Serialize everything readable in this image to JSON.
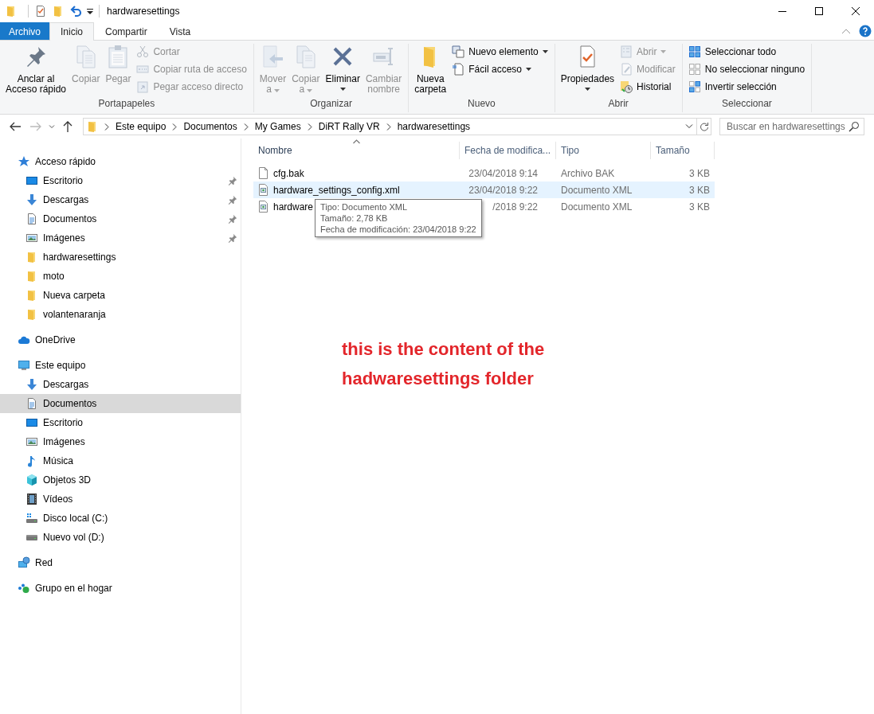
{
  "window": {
    "title": "hardwaresettings"
  },
  "ribbon": {
    "tabs": [
      {
        "label": "Archivo",
        "kind": "file",
        "selected": false
      },
      {
        "label": "Inicio",
        "kind": "tab",
        "selected": true
      },
      {
        "label": "Compartir",
        "kind": "tab",
        "selected": false
      },
      {
        "label": "Vista",
        "kind": "tab",
        "selected": false
      }
    ],
    "groups": [
      {
        "label": "Portapapeles",
        "large": [
          {
            "label": "Anclar al\nAcceso rápido",
            "kind": "pin",
            "disabled": false,
            "dropdown": false
          },
          {
            "label": "Copiar",
            "kind": "copy",
            "disabled": true,
            "dropdown": false
          },
          {
            "label": "Pegar",
            "kind": "paste",
            "disabled": true,
            "dropdown": false
          }
        ],
        "small": [
          {
            "label": "Cortar",
            "kind": "cut",
            "disabled": true,
            "dropdown": false
          },
          {
            "label": "Copiar ruta de acceso",
            "kind": "copypath",
            "disabled": true,
            "dropdown": false
          },
          {
            "label": "Pegar acceso directo",
            "kind": "pasteshortcut",
            "disabled": true,
            "dropdown": false
          }
        ]
      },
      {
        "label": "Organizar",
        "large": [
          {
            "label": "Mover\na",
            "kind": "move",
            "disabled": true,
            "dropdown": true
          },
          {
            "label": "Copiar\na",
            "kind": "copyto",
            "disabled": true,
            "dropdown": true
          },
          {
            "label": "Eliminar",
            "kind": "delete",
            "disabled": false,
            "dropdown": true
          },
          {
            "label": "Cambiar\nnombre",
            "kind": "rename",
            "disabled": true,
            "dropdown": false
          }
        ]
      },
      {
        "label": "Nuevo",
        "large": [
          {
            "label": "Nueva\ncarpeta",
            "kind": "newfolder",
            "disabled": false,
            "dropdown": false
          }
        ],
        "small": [
          {
            "label": "Nuevo elemento",
            "kind": "newitem",
            "disabled": false,
            "dropdown": true
          },
          {
            "label": "Fácil acceso",
            "kind": "easyaccess",
            "disabled": false,
            "dropdown": true
          }
        ]
      },
      {
        "label": "Abrir",
        "large": [
          {
            "label": "Propiedades",
            "kind": "properties",
            "disabled": false,
            "dropdown": true
          }
        ],
        "small": [
          {
            "label": "Abrir",
            "kind": "open",
            "disabled": true,
            "dropdown": true
          },
          {
            "label": "Modificar",
            "kind": "edit",
            "disabled": true,
            "dropdown": false
          },
          {
            "label": "Historial",
            "kind": "history",
            "disabled": false,
            "dropdown": false
          }
        ]
      },
      {
        "label": "Seleccionar",
        "small": [
          {
            "label": "Seleccionar todo",
            "kind": "selectall",
            "disabled": false,
            "dropdown": false
          },
          {
            "label": "No seleccionar ninguno",
            "kind": "selectnone",
            "disabled": false,
            "dropdown": false
          },
          {
            "label": "Invertir selección",
            "kind": "invert",
            "disabled": false,
            "dropdown": false
          }
        ]
      }
    ]
  },
  "navigation": {
    "back": {
      "disabled": false
    },
    "forward": {
      "disabled": true
    },
    "up": {
      "disabled": false
    }
  },
  "address": {
    "path": [
      "Este equipo",
      "Documentos",
      "My Games",
      "DiRT Rally VR",
      "hardwaresettings"
    ]
  },
  "search": {
    "placeholder": "Buscar en hardwaresettings"
  },
  "sidebar": {
    "items": [
      {
        "label": "Acceso rápido",
        "kind": "star",
        "selected": false,
        "children": [
          {
            "label": "Escritorio",
            "kind": "desktop",
            "pinned": true,
            "selected": false
          },
          {
            "label": "Descargas",
            "kind": "download",
            "pinned": true,
            "selected": false
          },
          {
            "label": "Documentos",
            "kind": "document",
            "pinned": true,
            "selected": false
          },
          {
            "label": "Imágenes",
            "kind": "picture",
            "pinned": true,
            "selected": false
          },
          {
            "label": "hardwaresettings",
            "kind": "folder",
            "pinned": false,
            "selected": false
          },
          {
            "label": "moto",
            "kind": "folder",
            "pinned": false,
            "selected": false
          },
          {
            "label": "Nueva carpeta",
            "kind": "folder",
            "pinned": false,
            "selected": false
          },
          {
            "label": "volantenaranja",
            "kind": "folder",
            "pinned": false,
            "selected": false
          }
        ]
      },
      {
        "label": "OneDrive",
        "kind": "cloud",
        "selected": false
      },
      {
        "label": "Este equipo",
        "kind": "computer",
        "selected": false,
        "children": [
          {
            "label": "Descargas",
            "kind": "download",
            "pinned": false,
            "selected": false
          },
          {
            "label": "Documentos",
            "kind": "document",
            "pinned": false,
            "selected": true
          },
          {
            "label": "Escritorio",
            "kind": "desktop",
            "pinned": false,
            "selected": false
          },
          {
            "label": "Imágenes",
            "kind": "picture",
            "pinned": false,
            "selected": false
          },
          {
            "label": "Música",
            "kind": "music",
            "pinned": false,
            "selected": false
          },
          {
            "label": "Objetos 3D",
            "kind": "cube",
            "pinned": false,
            "selected": false
          },
          {
            "label": "Vídeos",
            "kind": "video",
            "pinned": false,
            "selected": false
          },
          {
            "label": "Disco local (C:)",
            "kind": "systemdrive",
            "pinned": false,
            "selected": false
          },
          {
            "label": "Nuevo vol (D:)",
            "kind": "drive",
            "pinned": false,
            "selected": false
          }
        ]
      },
      {
        "label": "Red",
        "kind": "network",
        "selected": false
      },
      {
        "label": "Grupo en el hogar",
        "kind": "homegroup",
        "selected": false
      }
    ]
  },
  "files": {
    "columns": [
      {
        "label": "Nombre",
        "sorted": true
      },
      {
        "label": "Fecha de modifica...",
        "sorted": false
      },
      {
        "label": "Tipo",
        "sorted": false
      },
      {
        "label": "Tamaño",
        "sorted": false
      }
    ],
    "rows": [
      {
        "name": "cfg.bak",
        "date": "23/04/2018 9:14",
        "type": "Archivo BAK",
        "size": "3 KB",
        "kind": "file",
        "hovered": false,
        "selected": false
      },
      {
        "name": "hardware_settings_config.xml",
        "date": "23/04/2018 9:22",
        "type": "Documento XML",
        "size": "3 KB",
        "kind": "xml",
        "hovered": true,
        "selected": false
      },
      {
        "name": "hardware",
        "date": "/2018 9:22",
        "type": "Documento XML",
        "size": "3 KB",
        "kind": "xml",
        "hovered": false,
        "selected": false
      }
    ]
  },
  "tooltip": {
    "lines": [
      "Tipo: Documento XML",
      "Tamaño: 2,78 KB",
      "Fecha de modificación: 23/04/2018 9:22"
    ]
  },
  "annotation": {
    "text": "this is the content of the\nhadwaresettings folder"
  }
}
